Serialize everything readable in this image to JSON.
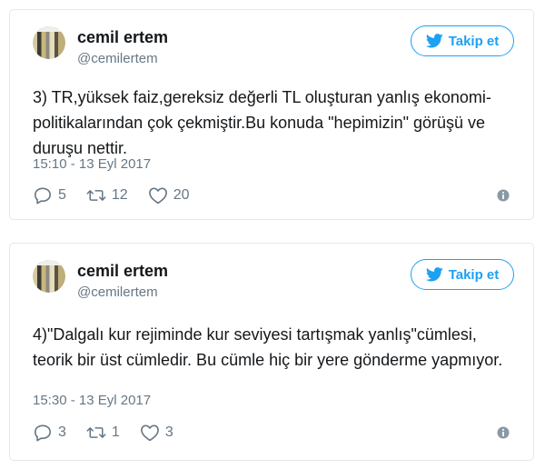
{
  "colors": {
    "accent": "#1da1f2",
    "muted": "#657786",
    "border": "#e1e8ed"
  },
  "tweets": [
    {
      "author_name": "cemil ertem",
      "author_handle": "@cemilertem",
      "follow_label": "Takip et",
      "text": "3) TR,yüksek faiz,gereksiz değerli TL oluşturan yanlış ekonomi-politikalarından çok çekmiştir.Bu konuda \"hepimizin\" görüşü ve duruşu nettir.",
      "timestamp": "15:10 - 13 Eyl 2017",
      "replies": "5",
      "retweets": "12",
      "likes": "20"
    },
    {
      "author_name": "cemil ertem",
      "author_handle": "@cemilertem",
      "follow_label": "Takip et",
      "text": "4)\"Dalgalı kur rejiminde kur seviyesi tartışmak yanlış\"cümlesi, teorik bir üst cümledir. Bu cümle hiç bir yere gönderme yapmıyor.",
      "timestamp": "15:30 - 13 Eyl 2017",
      "replies": "3",
      "retweets": "1",
      "likes": "3"
    }
  ]
}
